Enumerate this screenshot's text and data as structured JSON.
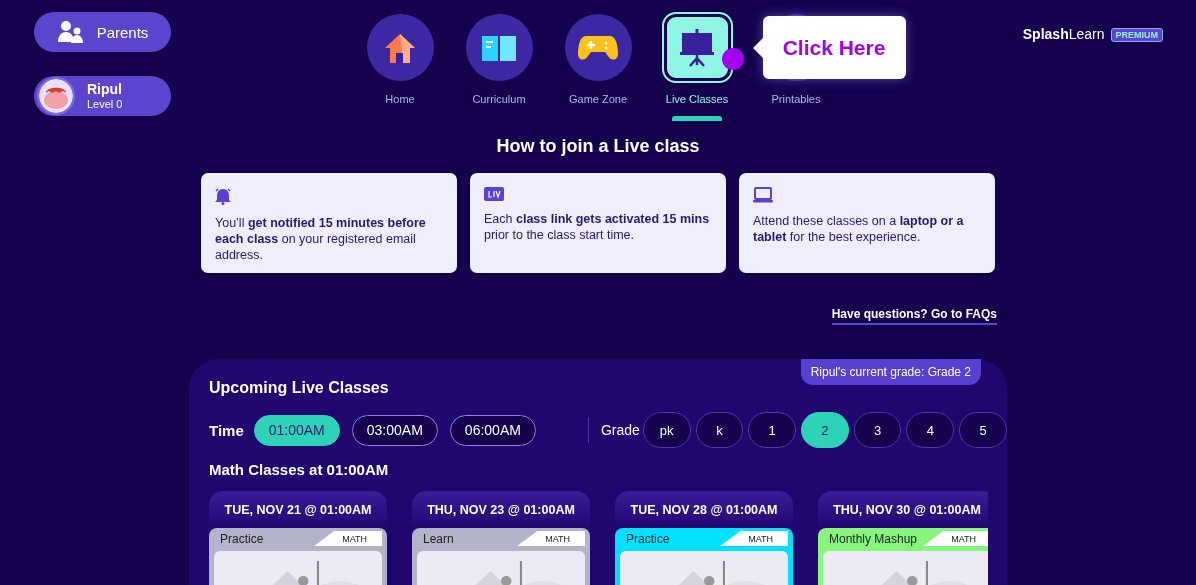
{
  "sidebar": {
    "parents_button": "Parents",
    "profile": {
      "name": "Ripul",
      "level": "Level 0"
    }
  },
  "nav": [
    {
      "label": "Home",
      "selected": false
    },
    {
      "label": "Curriculum",
      "selected": false
    },
    {
      "label": "Game Zone",
      "selected": false
    },
    {
      "label": "Live Classes",
      "selected": true
    },
    {
      "label": "Printables",
      "selected": false
    }
  ],
  "tooltip": {
    "text": "Click Here"
  },
  "brand": {
    "name": "**Splash**Learn",
    "badge": "PREMIUM"
  },
  "info": {
    "title": "How to join a Live class",
    "cards": [
      {
        "text": "You’ll **get notified 15 minutes before each class** on your registered email address."
      },
      {
        "text": "Each **class link gets activated 15 mins** prior to the class start time."
      },
      {
        "text": "Attend these classes on a **laptop or a tablet** for the best experience."
      }
    ],
    "faq_link": "Have questions? Go to FAQs"
  },
  "upcoming": {
    "title": "Upcoming Live Classes",
    "grade_badge": "Ripul's current grade: Grade 2",
    "time_label": "Time",
    "times": [
      {
        "label": "01:00AM",
        "selected": true
      },
      {
        "label": "03:00AM",
        "selected": false
      },
      {
        "label": "06:00AM",
        "selected": false
      }
    ],
    "grade_label": "Grade",
    "grades": [
      {
        "label": "pk",
        "selected": false
      },
      {
        "label": "k",
        "selected": false
      },
      {
        "label": "1",
        "selected": false
      },
      {
        "label": "2",
        "selected": true
      },
      {
        "label": "3",
        "selected": false
      },
      {
        "label": "4",
        "selected": false
      },
      {
        "label": "5",
        "selected": false
      }
    ],
    "section_title": "Math Classes at 01:00AM",
    "classes": [
      {
        "date": "TUE, NOV 21 @ 01:00AM",
        "type": "Practice",
        "subject": "MATH",
        "color": "#b3b3c9"
      },
      {
        "date": "THU, NOV 23 @ 01:00AM",
        "type": "Learn",
        "subject": "MATH",
        "color": "#b3b3c9"
      },
      {
        "date": "TUE, NOV 28 @ 01:00AM",
        "type": "Practice",
        "subject": "MATH",
        "color": "#00e1ff"
      },
      {
        "date": "THU, NOV 30 @ 01:00AM",
        "type": "Monthly Mashup",
        "subject": "MATH",
        "color": "#86f77c"
      }
    ]
  }
}
